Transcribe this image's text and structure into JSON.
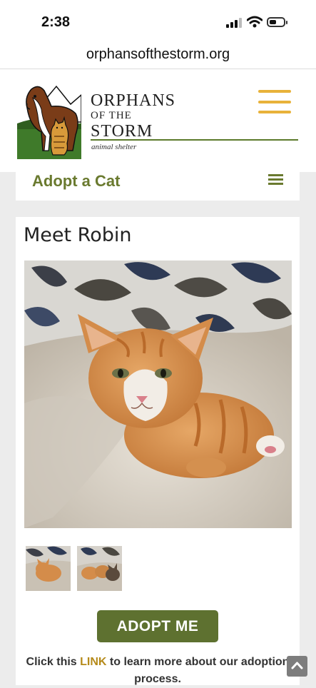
{
  "status_bar": {
    "time": "2:38"
  },
  "browser": {
    "url": "orphansofthestorm.org"
  },
  "site": {
    "brand_line1": "ORPHANS",
    "brand_line2": "OF THE",
    "brand_line3": "STORM",
    "brand_tagline": "animal shelter"
  },
  "section": {
    "title": "Adopt a Cat"
  },
  "pet": {
    "title": "Meet Robin",
    "adopt_button": "ADOPT ME",
    "info_prefix": "Click this ",
    "info_link": "LINK",
    "info_suffix": " to learn more about our adoption process."
  },
  "colors": {
    "brand_green": "#5e7130",
    "section_title": "#6a7a2f",
    "hamburger_gold": "#e8b23a",
    "link_gold": "#b58a1a"
  },
  "icons": {
    "main_menu": "hamburger-icon",
    "section_menu": "hamburger-icon",
    "scroll_top": "chevron-up-icon"
  }
}
